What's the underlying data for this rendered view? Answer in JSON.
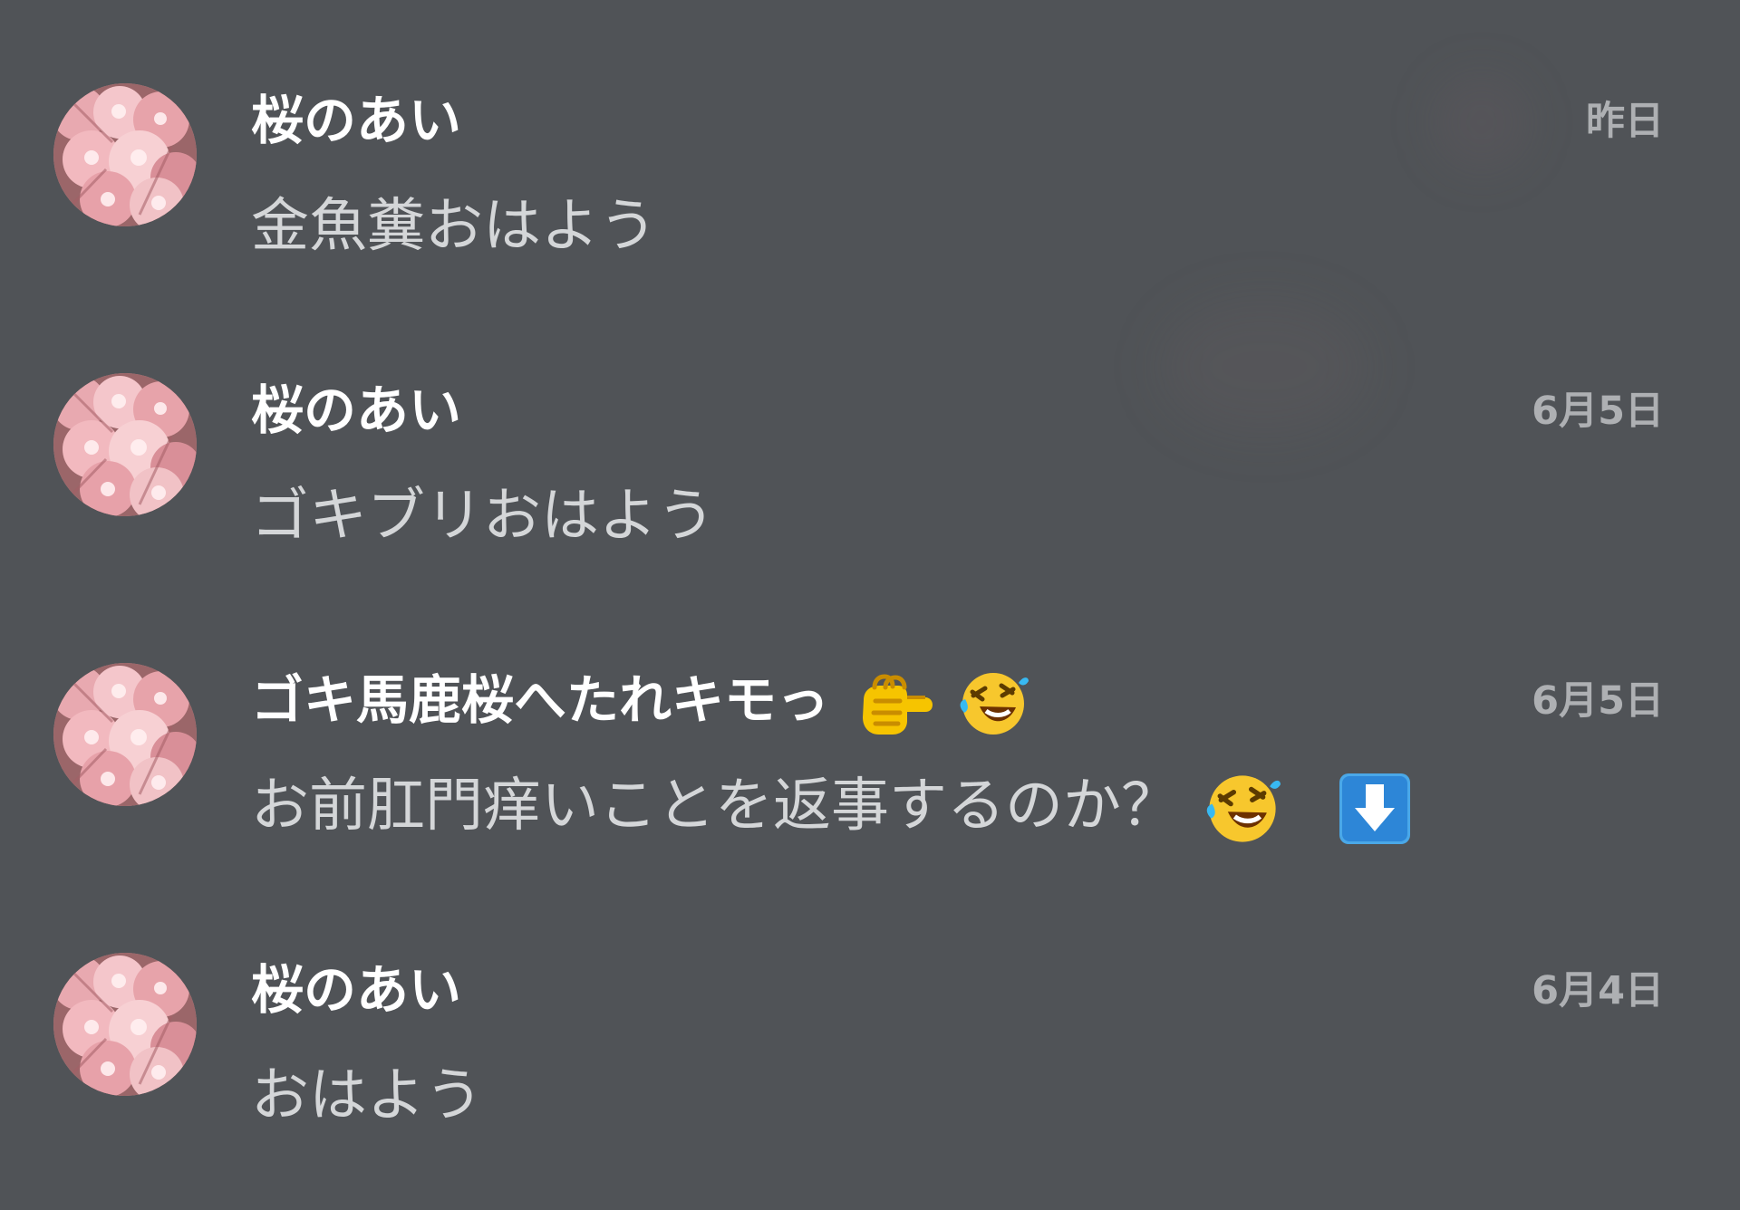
{
  "app": {
    "background_color": "#505357"
  },
  "chats": [
    {
      "sender": "桜のあい",
      "time": "昨日",
      "message": "金魚糞おはよう",
      "avatar_icon": "cherry-blossom-avatar"
    },
    {
      "sender": "桜のあい",
      "time": "6月5日",
      "message": "ゴキブリおはよう",
      "avatar_icon": "cherry-blossom-avatar"
    },
    {
      "sender": "ゴキ馬鹿桜へたれキモっ",
      "time": "6月5日",
      "message": "お前肛門痒いことを返事するのか？",
      "avatar_icon": "cherry-blossom-avatar",
      "sender_emojis": [
        "pointing-fist-emoji",
        "rolling-laugh-emoji"
      ],
      "message_emojis": [
        "rolling-laugh-emoji",
        "down-arrow-icon"
      ]
    },
    {
      "sender": "桜のあい",
      "time": "6月4日",
      "message": "おはよう",
      "avatar_icon": "cherry-blossom-avatar"
    }
  ],
  "colors": {
    "name_text": "#ffffff",
    "time_text": "#aeb0b3",
    "message_text": "#d4d6d8",
    "avatar_pink": "#f0b7bd",
    "avatar_shadow": "#8d5f61"
  }
}
